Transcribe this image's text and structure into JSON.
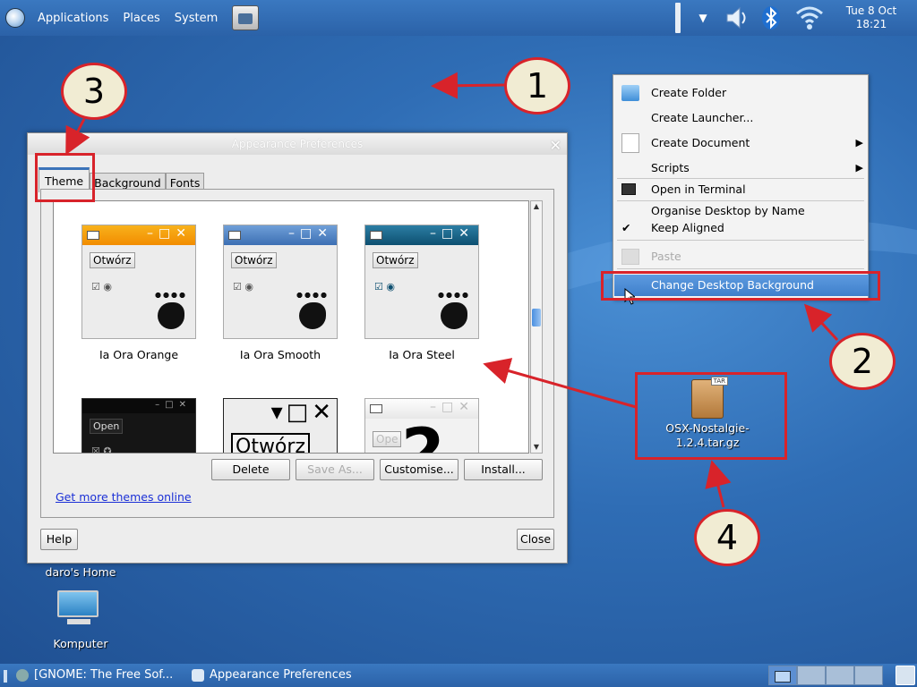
{
  "top_panel": {
    "menus": [
      "Applications",
      "Places",
      "System"
    ],
    "clock": {
      "line1": "Tue  8 Oct",
      "line2": "18:21"
    }
  },
  "window": {
    "title": "Appearance Preferences",
    "tabs": [
      "Theme",
      "Background",
      "Fonts"
    ],
    "themes": [
      {
        "name": "Ia Ora Orange",
        "button": "Otwórz"
      },
      {
        "name": "Ia Ora Smooth",
        "button": "Otwórz"
      },
      {
        "name": "Ia Ora Steel",
        "button": "Otwórz"
      },
      {
        "name": "",
        "button": "Open"
      },
      {
        "name": "",
        "button": "Otwórz"
      },
      {
        "name": "",
        "button": "Ope",
        "big": "2"
      }
    ],
    "buttons": {
      "delete": "Delete",
      "save_as": "Save As...",
      "customise": "Customise...",
      "install": "Install..."
    },
    "link": "Get more themes online",
    "help": "Help",
    "close": "Close"
  },
  "context_menu": {
    "items": [
      "Create Folder",
      "Create Launcher...",
      "Create Document",
      "Scripts",
      "Open in Terminal",
      "Organise Desktop by Name",
      "Keep Aligned",
      "Paste",
      "Change Desktop Background"
    ]
  },
  "annotations": [
    "1",
    "2",
    "3",
    "4"
  ],
  "desktop": {
    "home_label": "daro's Home",
    "computer_label": "Komputer",
    "file_label": "OSX-Nostalgie-1.2.4.tar.gz",
    "tar_tag": "TAR"
  },
  "bottom_panel": {
    "tasks": [
      "[GNOME: The Free Sof...",
      "Appearance Preferences"
    ]
  },
  "colors": {
    "accent": "#3b73b9",
    "annotation_red": "#d8232a",
    "callout_fill": "#f1ecd3",
    "link": "#1a2fd6"
  }
}
